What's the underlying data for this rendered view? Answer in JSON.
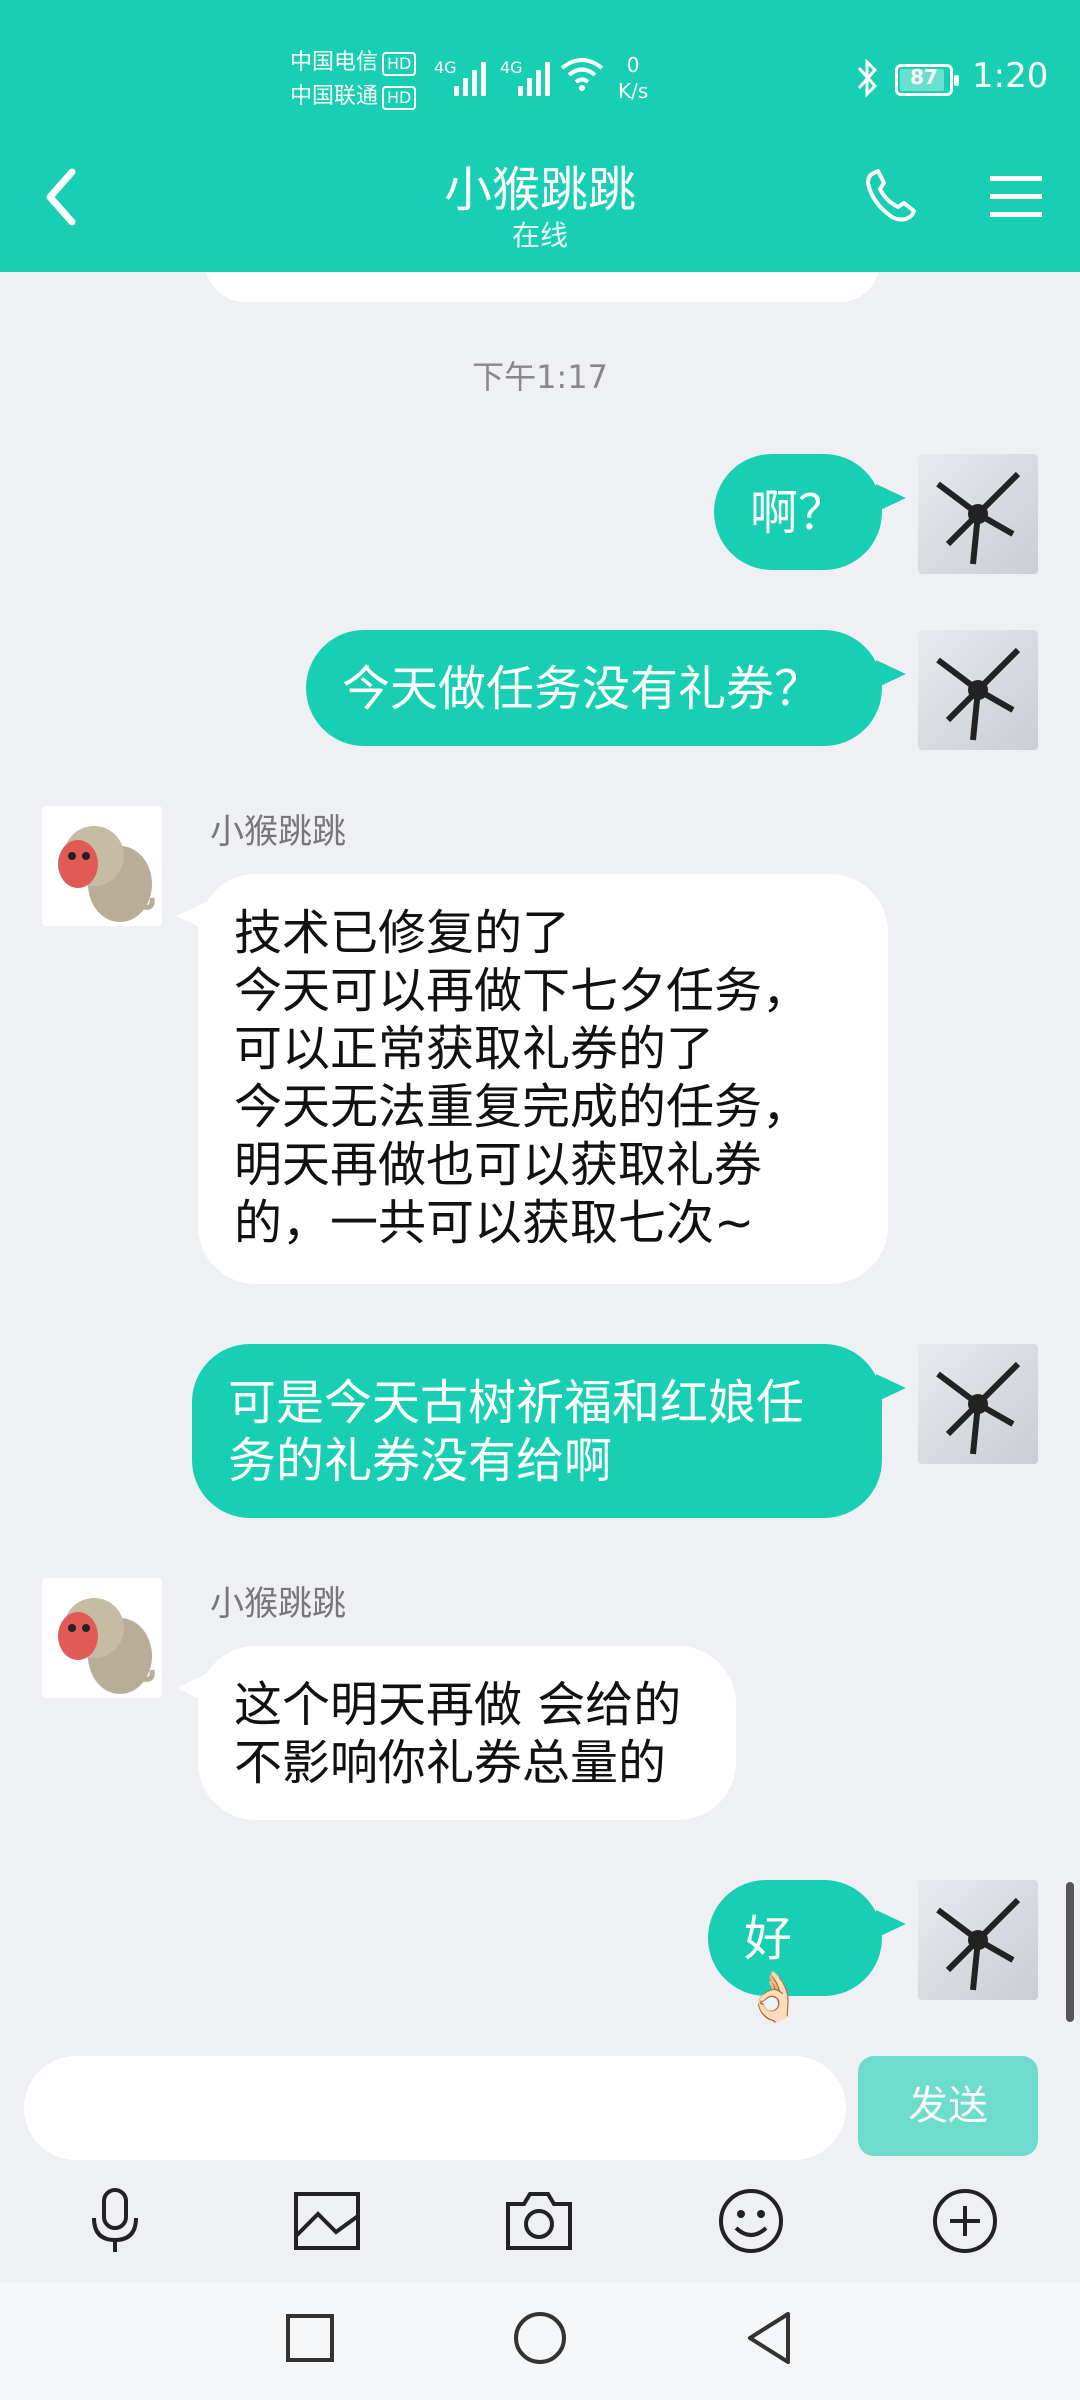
{
  "status": {
    "carrier1": "中国电信",
    "carrier2": "中国联通",
    "hd": "HD",
    "net1": "4G",
    "net2": "4G",
    "speed_value": "0",
    "speed_unit": "K/s",
    "battery": "87",
    "time": "1:20"
  },
  "header": {
    "title": "小猴跳跳",
    "subtitle": "在线"
  },
  "chat": {
    "timestamp": "下午1:17",
    "messages": [
      {
        "from": "me",
        "text": "啊？"
      },
      {
        "from": "me",
        "text": "今天做任务没有礼券？"
      },
      {
        "from": "peer",
        "sender": "小猴跳跳",
        "text": "技术已修复的了\n今天可以再做下七夕任务，\n可以正常获取礼券的了\n今天无法重复完成的任务，\n明天再做也可以获取礼券\n的，一共可以获取七次~"
      },
      {
        "from": "me",
        "text": "可是今天古树祈福和红娘任\n务的礼券没有给啊"
      },
      {
        "from": "peer",
        "sender": "小猴跳跳",
        "text": "这个明天再做 会给的\n不影响你礼券总量的"
      },
      {
        "from": "me",
        "text": "好👌🏻"
      }
    ]
  },
  "input": {
    "placeholder": "",
    "send_label": "发送"
  },
  "toolbar": [
    "microphone-icon",
    "image-icon",
    "camera-icon",
    "emoji-icon",
    "plus-icon"
  ],
  "colors": {
    "accent": "#18cfb4",
    "background": "#eef0f4"
  }
}
